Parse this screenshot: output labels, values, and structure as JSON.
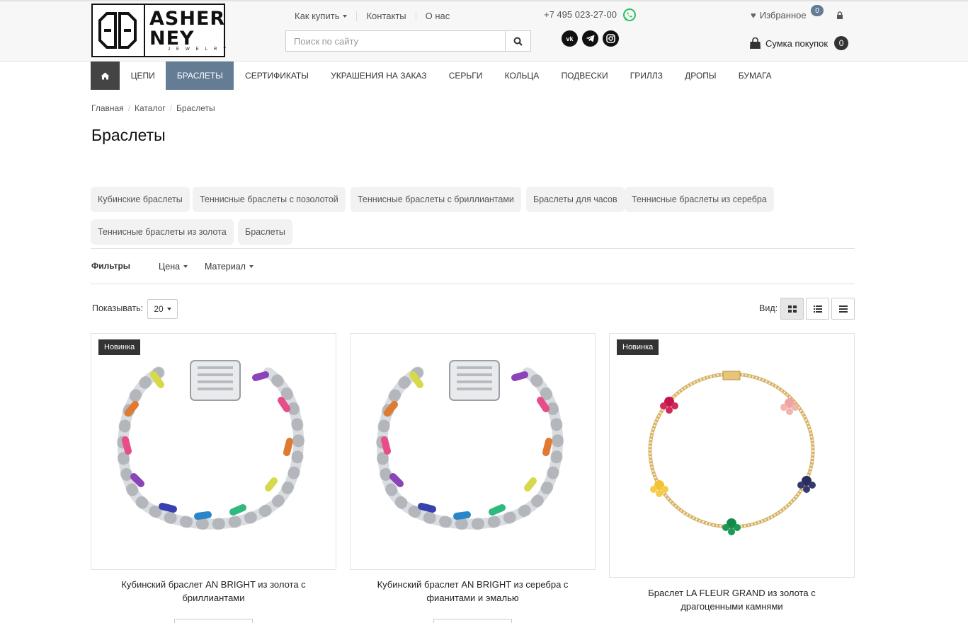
{
  "logo": {
    "line1": "ASHER",
    "line2": "NEY",
    "line3": "JEWELRY"
  },
  "header": {
    "links": [
      {
        "label": "Как купить",
        "dropdown": true
      },
      {
        "label": "Контакты",
        "dropdown": false
      },
      {
        "label": "О нас",
        "dropdown": false
      }
    ],
    "search_placeholder": "Поиск по сайту",
    "phone": "+7 495 023-27-00",
    "socials": [
      "vk-icon",
      "telegram-icon",
      "instagram-icon"
    ],
    "favorites_label": "Избранное",
    "favorites_count": "0",
    "cart_label": "Сумка покупок",
    "cart_count": "0"
  },
  "nav": {
    "items": [
      "Цепи",
      "Браслеты",
      "Сертификаты",
      "Украшения на заказ",
      "Серьги",
      "Кольца",
      "Подвески",
      "Гриллз",
      "Дропы",
      "Бумага"
    ],
    "active_index": 1
  },
  "breadcrumb": [
    "Главная",
    "Каталог",
    "Браслеты"
  ],
  "page_title": "Браслеты",
  "subcategories": [
    "Кубинские браслеты",
    "Теннисные браслеты с позолотой",
    "Теннисные браслеты с бриллиантами",
    "Браслеты для часов",
    "Теннисные браслеты из серебра",
    "Теннисные браслеты из золота",
    "Браслеты"
  ],
  "filters": {
    "label": "Фильтры",
    "price": "Цена",
    "material": "Материал"
  },
  "listing": {
    "show_label": "Показывать:",
    "show_value": "20",
    "view_label": "Вид:"
  },
  "products": [
    {
      "name": "Кубинский браслет AN BRIGHT из золота с бриллиантами",
      "badge": "Новинка"
    },
    {
      "name": "Кубинский браслет AN BRIGHT из серебра с фианитами и эмалью",
      "badge": ""
    },
    {
      "name": "Браслет LA FLEUR GRAND из золота с драгоценными камнями",
      "badge": "Новинка"
    }
  ],
  "colors": {
    "accent": "#647c94",
    "dark": "#333333"
  }
}
